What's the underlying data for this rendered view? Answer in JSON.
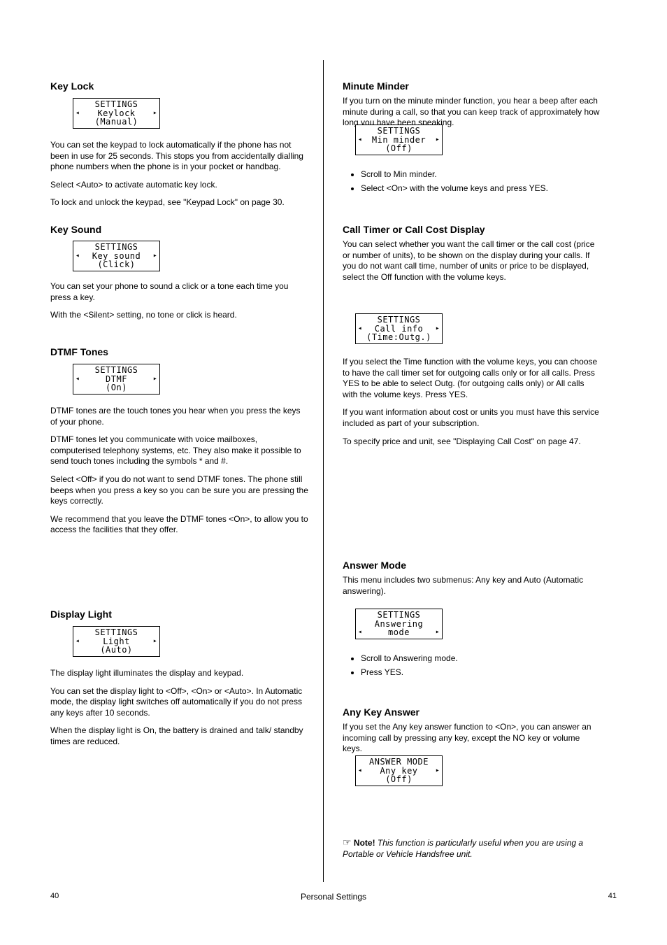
{
  "page_number_left": "40",
  "page_number_right": "41",
  "footer_title": "Personal Settings",
  "left": {
    "keylock": {
      "title": "Key Lock",
      "lcd_title": "SETTINGS",
      "lcd_item": "Keylock",
      "lcd_value": "(Manual)",
      "para1": "You can set the keypad to lock automatically if the phone has not been in use for 25 seconds. This stops you from accidentally dialling phone numbers when the phone is in your pocket or handbag.",
      "para2": "Select <Auto> to activate automatic key lock.",
      "para3": "To lock and unlock the keypad, see \"Keypad Lock\" on page 30."
    },
    "keysound": {
      "title": "Key Sound",
      "lcd_title": "SETTINGS",
      "lcd_item": "Key sound",
      "lcd_value": "(Click)",
      "para1": "You can set your phone to sound a click or a tone each time you press a key.",
      "para2": "With the <Silent> setting, no tone or click is heard."
    },
    "dtmf": {
      "title": "DTMF Tones",
      "lcd_title": "SETTINGS",
      "lcd_item": "DTMF",
      "lcd_value": "(On)",
      "para1": "DTMF tones are the touch tones you hear when you press the keys of your phone.",
      "para2": "DTMF tones let you communicate with voice mailboxes, computerised telephony systems, etc. They also make it possible to send touch tones including the symbols",
      "star_hash_line": "*     and      #",
      "para3": ".",
      "para4": "Select <Off> if you do not want to send DTMF tones. The phone still beeps when you press a key so you can be sure you are pressing the keys correctly.",
      "para5": "We recommend that you leave the DTMF tones <On>, to allow you to access the facilities that they offer."
    },
    "light": {
      "title": "Display Light",
      "lcd_title": "SETTINGS",
      "lcd_item": "Light",
      "lcd_value": "(Auto)",
      "para1": "The display light illuminates the display and keypad.",
      "para2": "You can set the display light to <Off>, <On> or <Auto>. In Automatic mode, the display light switches off automatically if you do not press any keys after 10 seconds.",
      "para3": "When the display light is On, the battery is drained and talk/ standby times are reduced."
    }
  },
  "right": {
    "minute": {
      "title": "Minute Minder",
      "lcd_title": "SETTINGS",
      "lcd_item": "Min minder",
      "lcd_value": "(Off)",
      "para1": "If you turn on the minute minder function, you hear a beep after each minute during a call, so that you can keep track of approximately how long you have been speaking.",
      "bullet1": "Scroll to Min minder.",
      "bullet2": "Select <On> with the volume keys and press YES."
    },
    "callinfo": {
      "title": "Call Timer or Call Cost Display",
      "lcd_title": "SETTINGS",
      "lcd_item": "Call info",
      "lcd_value": "(Time:Outg.)",
      "para1": "You can select whether you want the call timer or the call cost (price or number of units), to be shown on the display during your calls. If you do not want call time, number of units or price to be displayed, select the Off function with the volume keys.",
      "para2": "If you select the Time function with the volume keys, you can choose to have the call timer set for outgoing calls only or for all calls. Press YES to be able to select Outg. (for outgoing calls only) or All calls with the volume keys. Press YES.",
      "para3": "If you want information about cost or units you must have this service included as part of your subscription.",
      "para4": "To specify price and unit, see \"Displaying Call Cost\" on page 47."
    },
    "answer": {
      "title": "Answer Mode",
      "lcd_title": "SETTINGS",
      "lcd_label_a": "Answering",
      "lcd_label_b": "mode",
      "para1": "This menu includes two submenus: Any key and Auto (Automatic answering).",
      "bullet1": "Scroll to Answering mode.",
      "bullet2": "Press YES."
    },
    "anykey": {
      "title": "Any Key Answer",
      "lcd_title": "ANSWER MODE",
      "lcd_item": "Any key",
      "lcd_value": "(Off)",
      "para1": "If you set the Any key answer function to <On>, you can answer an incoming call by pressing any key, except the NO key or volume keys.",
      "note_icon": "☞",
      "note_label": "Note!",
      "note_text": " This function is particularly useful when you are using a Portable or Vehicle Handsfree unit."
    }
  }
}
